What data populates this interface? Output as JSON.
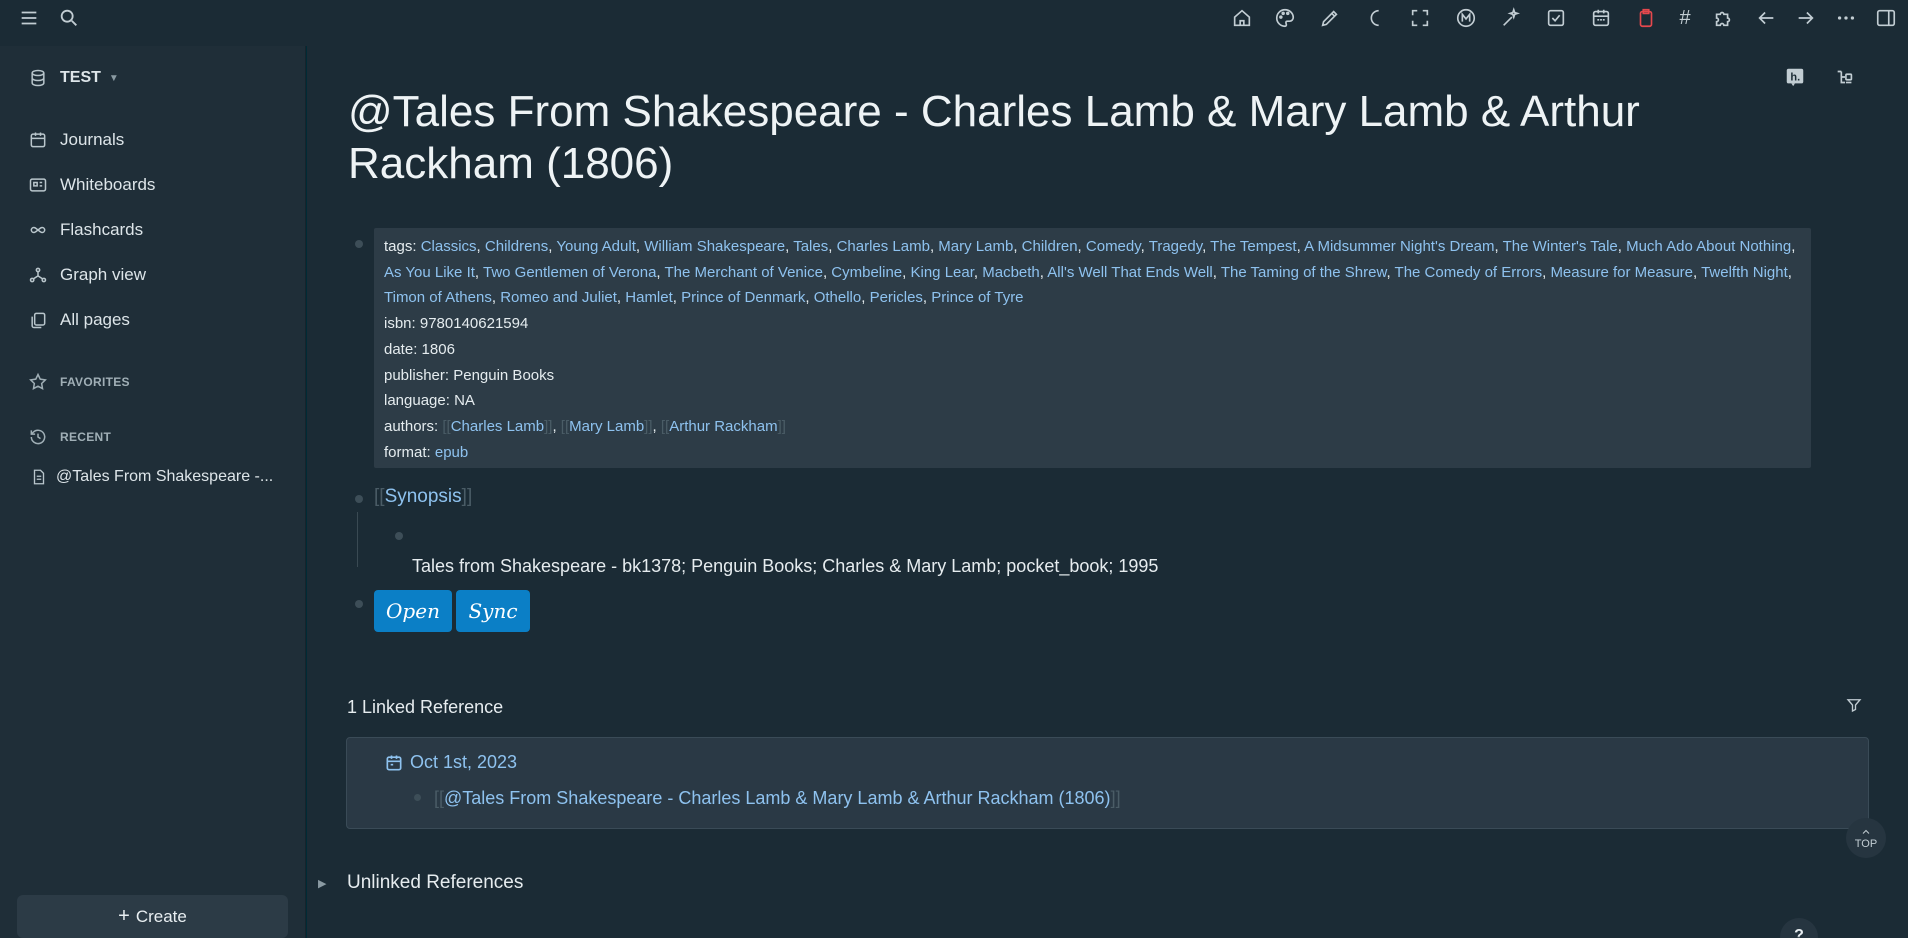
{
  "sidebar": {
    "graph_name": "TEST",
    "nav": [
      {
        "label": "Journals",
        "icon": "calendar-icon"
      },
      {
        "label": "Whiteboards",
        "icon": "whiteboard-icon"
      },
      {
        "label": "Flashcards",
        "icon": "infinity-icon"
      },
      {
        "label": "Graph view",
        "icon": "graph-icon"
      },
      {
        "label": "All pages",
        "icon": "pages-icon"
      }
    ],
    "favorites_label": "FAVORITES",
    "recent_label": "RECENT",
    "recent_items": [
      "@Tales From Shakespeare -..."
    ],
    "create_label": "Create"
  },
  "page": {
    "title": "@Tales From Shakespeare - Charles Lamb & Mary Lamb & Arthur Rackham (1806)",
    "properties": {
      "tags_key": "tags:",
      "tags": [
        "Classics",
        "Childrens",
        "Young Adult",
        "William Shakespeare",
        "Tales",
        "Charles Lamb",
        "Mary Lamb",
        "Children",
        "Comedy",
        "Tragedy",
        "The Tempest",
        "A Midsummer Night's Dream",
        "The Winter's Tale",
        "Much Ado About Nothing",
        "As You Like It",
        "Two Gentlemen of Verona",
        "The Merchant of Venice",
        "Cymbeline",
        "King Lear",
        "Macbeth",
        "All's Well That Ends Well",
        "The Taming of the Shrew",
        "The Comedy of Errors",
        "Measure for Measure",
        "Twelfth Night",
        "Timon of Athens",
        "Romeo and Juliet",
        "Hamlet",
        "Prince of Denmark",
        "Othello",
        "Pericles",
        "Prince of Tyre"
      ],
      "isbn_key": "isbn:",
      "isbn": "9780140621594",
      "date_key": "date:",
      "date": "1806",
      "publisher_key": "publisher:",
      "publisher": "Penguin Books",
      "language_key": "language:",
      "language": "NA",
      "authors_key": "authors:",
      "authors": [
        "Charles Lamb",
        "Mary Lamb",
        "Arthur Rackham"
      ],
      "format_key": "format:",
      "format": "epub"
    },
    "synopsis_label": "Synopsis",
    "synopsis_text": "Tales from Shakespeare - bk1378; Penguin Books; Charles & Mary Lamb; pocket_book; 1995",
    "buttons": {
      "open": "Open",
      "sync": "Sync"
    },
    "linked_refs_title": "1 Linked Reference",
    "ref_date": "Oct 1st, 2023",
    "ref_link": "@Tales From Shakespeare - Charles Lamb & Mary Lamb & Arthur Rackham (1806)",
    "unlinked_refs_title": "Unlinked References",
    "top_label": "TOP",
    "help_label": "?"
  },
  "toolbar": {
    "right_icons": [
      "home-icon",
      "palette-icon",
      "pencil-icon",
      "moon-icon",
      "fullscreen-icon",
      "logseq-m-icon",
      "star-wand-icon",
      "checkbox-icon",
      "calendar-icon",
      "clipboard-icon",
      "hashtag-icon",
      "puzzle-icon",
      "arrow-left-icon",
      "arrow-right-icon",
      "more-icon",
      "sidebar-toggle-icon"
    ],
    "accent_red": "#e5484d"
  },
  "colors": {
    "background": "#1b2b35",
    "sidebar": "#1f2e38",
    "link": "#8ec2ef",
    "button": "#0b7fc6"
  }
}
